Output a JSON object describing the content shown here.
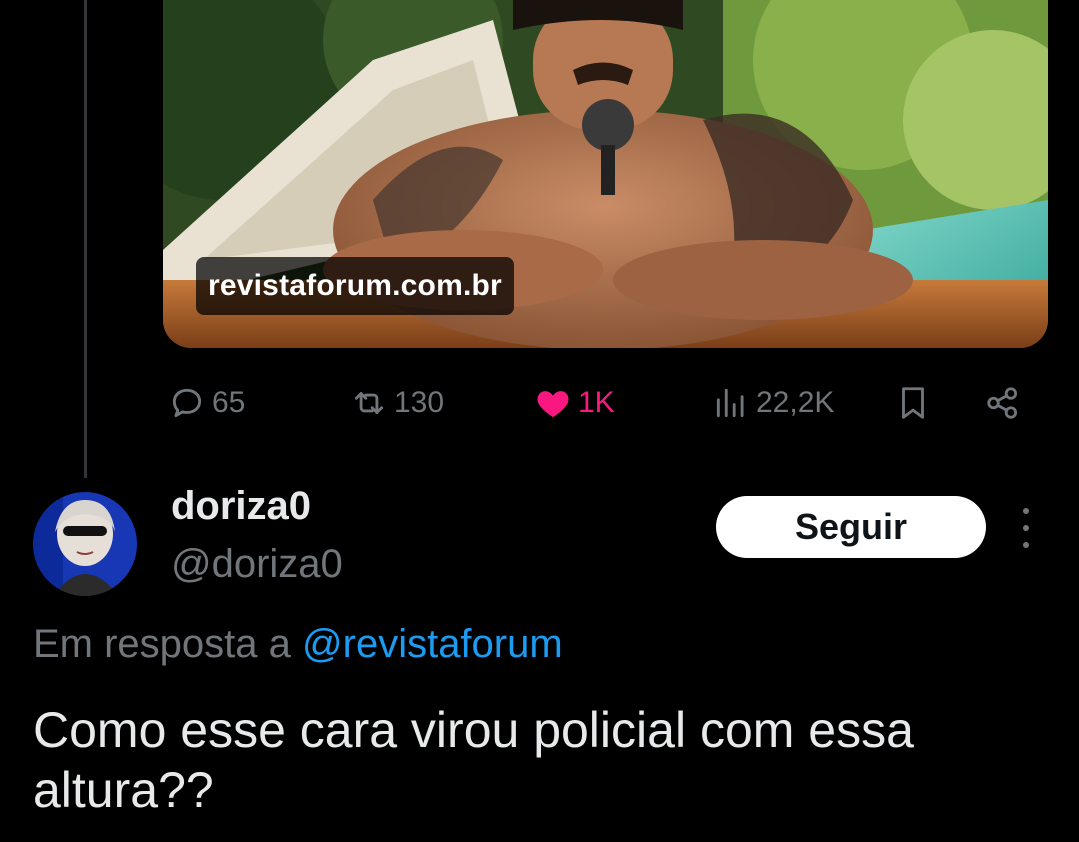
{
  "media": {
    "domain_label": "revistaforum.com.br"
  },
  "actions": {
    "replies": "65",
    "retweets": "130",
    "likes": "1K",
    "views": "22,2K"
  },
  "reply": {
    "display_name": "doriza0",
    "handle": "@doriza0",
    "follow_label": "Seguir",
    "in_reply_prefix": "Em resposta a",
    "in_reply_handle": "@revistaforum",
    "text": "Como esse cara virou policial com essa altura??"
  },
  "colors": {
    "background": "#000000",
    "muted": "#71767b",
    "like": "#f91880",
    "link": "#1d9bf0"
  }
}
